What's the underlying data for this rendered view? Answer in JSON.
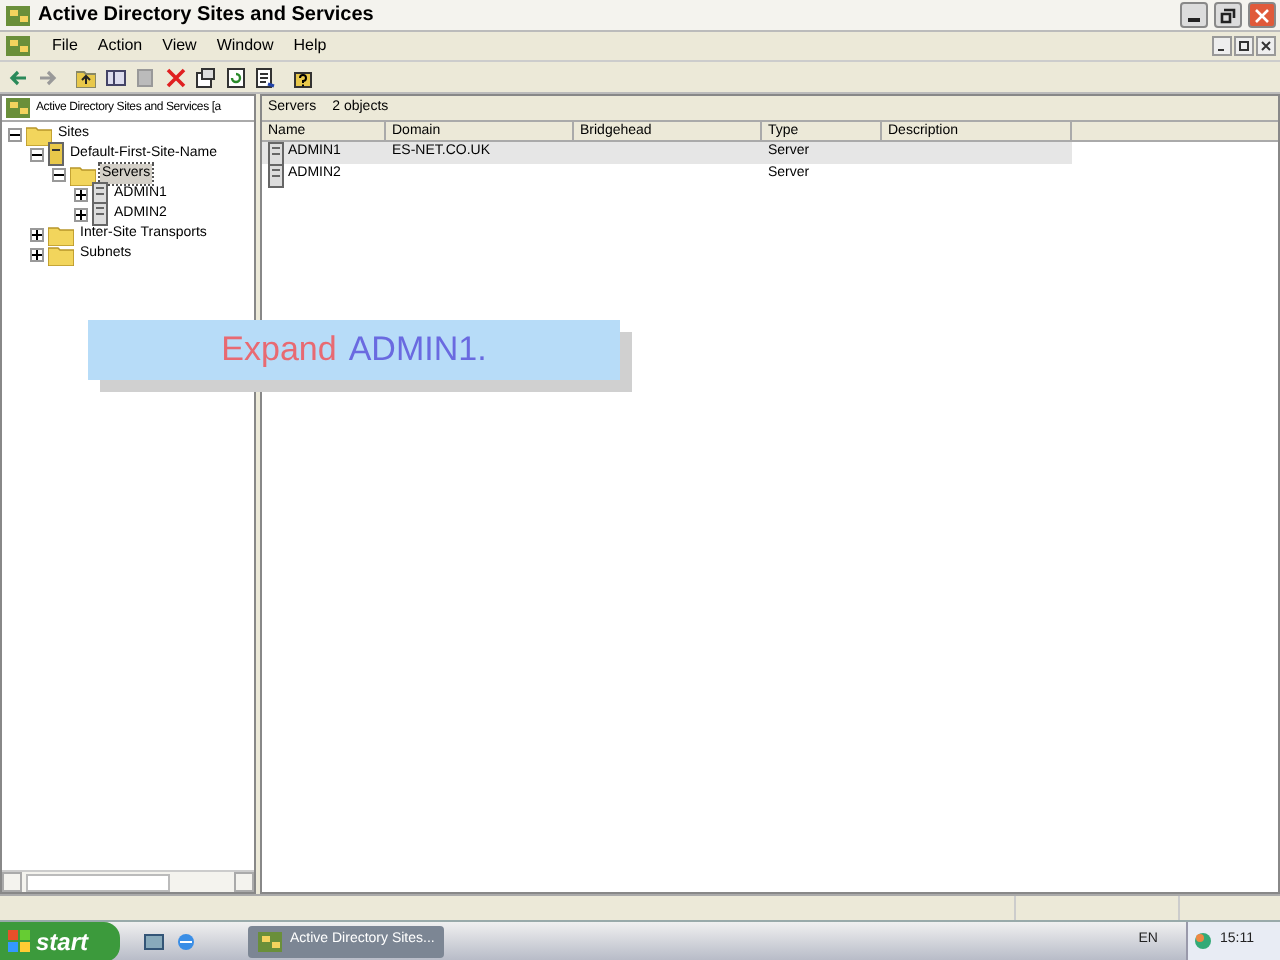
{
  "window": {
    "title": "Active Directory Sites and Services"
  },
  "menu": [
    "File",
    "Action",
    "View",
    "Window",
    "Help"
  ],
  "tree": {
    "label": "Active Directory Sites and Services [a",
    "children": [
      {
        "label": "Sites",
        "kind": "folder",
        "expanded": true,
        "selected": false,
        "children": [
          {
            "label": "Default-First-Site-Name",
            "kind": "site",
            "expanded": true,
            "selected": false,
            "children": [
              {
                "label": "Servers",
                "kind": "folder",
                "expanded": true,
                "selected": true,
                "children": [
                  {
                    "label": "ADMIN1",
                    "kind": "server",
                    "expanded": false,
                    "selected": false
                  },
                  {
                    "label": "ADMIN2",
                    "kind": "server",
                    "expanded": false,
                    "selected": false
                  }
                ]
              }
            ]
          },
          {
            "label": "Inter-Site Transports",
            "kind": "folder",
            "expanded": false,
            "selected": false
          },
          {
            "label": "Subnets",
            "kind": "folder",
            "expanded": false,
            "selected": false
          }
        ]
      }
    ]
  },
  "list": {
    "title": "Servers",
    "count": "2 objects",
    "columns": [
      "Name",
      "Domain",
      "Bridgehead",
      "Type",
      "Description"
    ],
    "rows": [
      {
        "cells": [
          "ADMIN1",
          "ES-NET.CO.UK",
          "",
          "Server",
          ""
        ],
        "selected": true
      },
      {
        "cells": [
          "ADMIN2",
          "",
          "",
          "Server",
          ""
        ],
        "selected": false
      }
    ]
  },
  "callout": {
    "action": "Expand",
    "target": "ADMIN1."
  },
  "taskbar": {
    "start": "start",
    "task": "Active Directory Sites...",
    "language": "EN",
    "clock": "15:11"
  }
}
